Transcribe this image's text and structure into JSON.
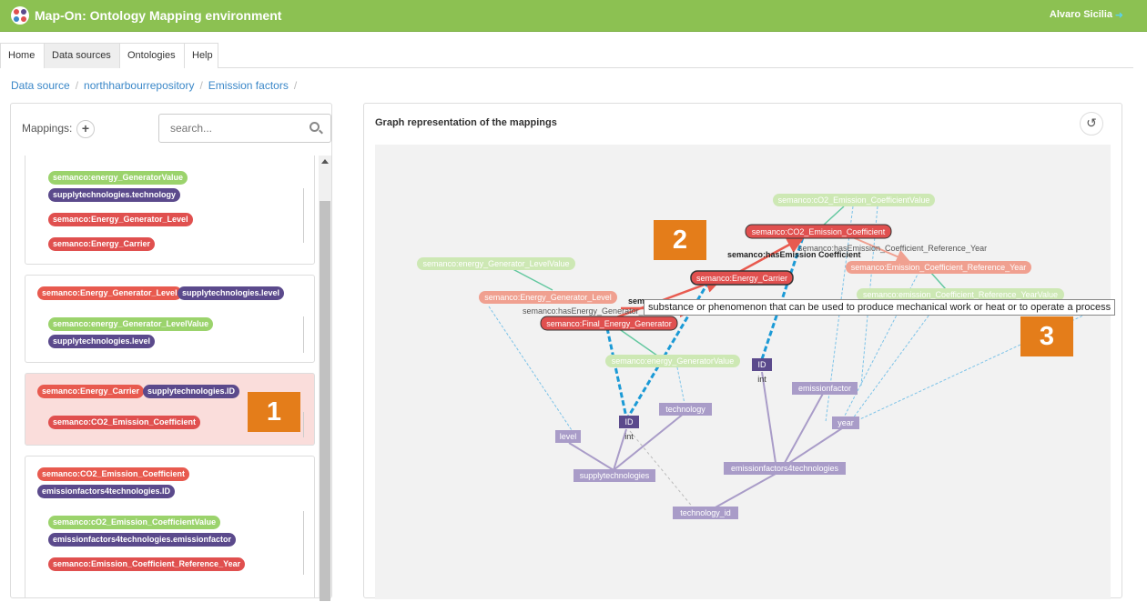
{
  "app": {
    "title": "Map-On: Ontology Mapping environment",
    "user": "Alvaro Sicilia",
    "logout_icon": "sign-out-icon"
  },
  "tabs": [
    {
      "label": "Home",
      "active": false
    },
    {
      "label": "Data sources",
      "active": true
    },
    {
      "label": "Ontologies",
      "active": false
    },
    {
      "label": "Help",
      "active": false
    }
  ],
  "breadcrumb": [
    "Data source",
    "northharbourrepository",
    "Emission factors"
  ],
  "left": {
    "mappings_label": "Mappings:",
    "search_placeholder": "search...",
    "cards": [
      {
        "tags": [
          "semanco:energy_GeneratorValue",
          "supplytechnologies.technology",
          "semanco:Energy_Generator_Level",
          "semanco:Energy_Carrier"
        ]
      },
      {
        "tags": [
          "semanco:Energy_Generator_Level",
          "supplytechnologies.level",
          "semanco:energy_Generator_LevelValue",
          "supplytechnologies.level"
        ]
      },
      {
        "tags": [
          "semanco:Energy_Carrier",
          "supplytechnologies.ID",
          "semanco:CO2_Emission_Coefficient"
        ]
      },
      {
        "tags": [
          "semanco:CO2_Emission_Coefficient",
          "emissionfactors4technologies.ID",
          "semanco:cO2_Emission_CoefficientValue",
          "emissionfactors4technologies.emissionfactor",
          "semanco:Emission_Coefficient_Reference_Year"
        ]
      }
    ]
  },
  "badges": [
    "1",
    "2",
    "3"
  ],
  "graph": {
    "title": "Graph representation of the mappings",
    "reset_icon": "undo-icon",
    "tooltip": "substance or phenomenon that can be used to produce mechanical work or heat or to operate a process",
    "nodes": {
      "co2_value": "semanco:cO2_Emission_CoefficientValue",
      "co2": "semanco:CO2_Emission_Coefficient",
      "carrier": "semanco:Energy_Carrier",
      "level_value": "semanco:energy_Generator_LevelValue",
      "gen_level": "semanco:Energy_Generator_Level",
      "final_gen": "semanco:Final_Energy_Generator",
      "gen_value": "semanco:energy_GeneratorValue",
      "ref_year": "semanco:Emission_Coefficient_Reference_Year",
      "ref_year_value": "semanco:emission_Coefficient_Reference_YearValue",
      "id1": "ID",
      "int1": "int",
      "id2": "ID",
      "int2": "int",
      "emissionfactor": "emissionfactor",
      "year": "year",
      "level": "level",
      "technology": "technology",
      "supplytechnologies": "supplytechnologies",
      "ef4t": "emissionfactors4technologies",
      "technology_id": "technology_id"
    },
    "edges": {
      "has_emission": "semanco:hasEmission Coefficient",
      "has_ref_year": "semanco:hasEmission_Coefficient_Reference_Year",
      "has_gen_level": "semanco:hasEnergy_Generator_Level",
      "sem_partial": "sem"
    }
  },
  "colors": {
    "topbar": "#8cc152",
    "badge": "#e47d1a",
    "accent": "#3a87c8"
  }
}
